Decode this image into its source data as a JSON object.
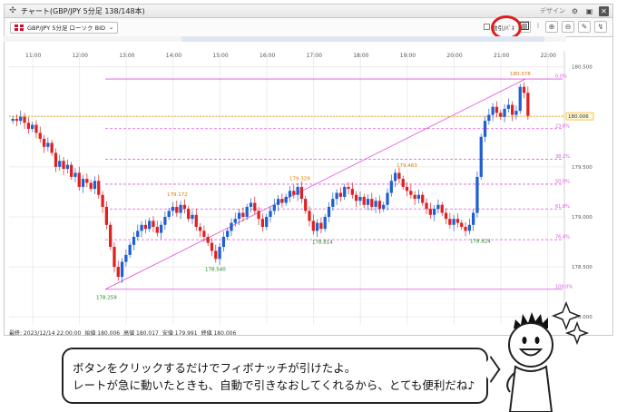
{
  "window": {
    "title": "チャート(GBP/JPY 5分足 138/148本)",
    "design_label": "デザイン",
    "title_icons": [
      "gear-icon",
      "window-icon",
      "close-icon"
    ]
  },
  "toolbar": {
    "symbol_select": "GBP/JPY 5分足 ローソク BID",
    "checkbox_label": "数引/ﾊﾞﾈ",
    "buttons": [
      "fibonacci-icon",
      "menu-icon",
      "zoom-in-icon",
      "zoom-out-icon",
      "pen-icon",
      "draw-tool-icon"
    ]
  },
  "status": {
    "datetime": "最終: 2023/12/14 22:00:00",
    "open": "始値 180.006",
    "high": "高値 180.017",
    "low": "安値 179.991",
    "close": "終値 180.006"
  },
  "bubble": {
    "line1": "ボタンをクリックするだけでフィボナッチが引けたよ。",
    "line2": "レートが急に動いたときも、自動で引きなおしてくれるから、とても便利だね♪"
  },
  "colors": {
    "up": "#1f5fd1",
    "down": "#e02020",
    "fib": "#e050e0",
    "current_price_line": "#f0a500",
    "highlight": "#e41a1a"
  },
  "chart_data": {
    "type": "candlestick",
    "x_ticks": [
      "11:00",
      "12:00",
      "13:00",
      "14:00",
      "15:00",
      "16:00",
      "17:00",
      "18:00",
      "19:00",
      "20:00",
      "21:00",
      "22:00"
    ],
    "y_ticks": [
      "180.500",
      "180.000",
      "179.500",
      "179.000",
      "178.500",
      "178.000"
    ],
    "ylim": [
      177.92,
      180.66
    ],
    "current_price": "180.006",
    "fib_levels": [
      {
        "label": "0.0%",
        "price": 180.378
      },
      {
        "label": "23.6%",
        "price": 179.882
      },
      {
        "label": "38.2%",
        "price": 179.575
      },
      {
        "label": "50.0%",
        "price": 179.327
      },
      {
        "label": "61.8%",
        "price": 179.079
      },
      {
        "label": "76.4%",
        "price": 178.772
      },
      {
        "label": "100.0%",
        "price": 178.276
      }
    ],
    "annotations": [
      {
        "text": "179.172",
        "kind": "high"
      },
      {
        "text": "179.329",
        "kind": "high"
      },
      {
        "text": "179.463",
        "kind": "high"
      },
      {
        "text": "180.378",
        "kind": "high"
      },
      {
        "text": "178.259",
        "kind": "low"
      },
      {
        "text": "178.540",
        "kind": "low"
      },
      {
        "text": "178.814",
        "kind": "low"
      },
      {
        "text": "178.824",
        "kind": "low"
      }
    ],
    "candles_close": [
      179.98,
      179.96,
      180.0,
      179.94,
      179.88,
      179.92,
      179.84,
      179.78,
      179.7,
      179.74,
      179.64,
      179.5,
      179.56,
      179.48,
      179.52,
      179.4,
      179.44,
      179.3,
      179.38,
      179.34,
      179.28,
      179.36,
      179.22,
      179.1,
      178.92,
      178.7,
      178.5,
      178.4,
      178.55,
      178.62,
      178.72,
      178.8,
      178.86,
      178.92,
      178.88,
      178.96,
      178.9,
      178.84,
      178.92,
      179.0,
      179.06,
      179.1,
      179.04,
      179.12,
      179.08,
      178.98,
      179.02,
      178.9,
      178.86,
      178.8,
      178.74,
      178.66,
      178.58,
      178.7,
      178.8,
      178.86,
      178.94,
      178.98,
      179.04,
      179.0,
      179.1,
      179.14,
      179.06,
      178.98,
      178.9,
      179.0,
      179.06,
      179.12,
      179.18,
      179.14,
      179.2,
      179.26,
      179.22,
      179.3,
      179.18,
      179.06,
      178.96,
      178.86,
      178.94,
      178.88,
      179.0,
      179.1,
      179.18,
      179.24,
      179.2,
      179.3,
      179.28,
      179.22,
      179.16,
      179.2,
      179.12,
      179.18,
      179.1,
      179.16,
      179.08,
      179.12,
      179.24,
      179.36,
      179.44,
      179.38,
      179.3,
      179.26,
      179.22,
      179.18,
      179.22,
      179.14,
      179.08,
      179.02,
      179.08,
      179.12,
      179.04,
      178.98,
      178.92,
      178.98,
      178.94,
      178.9,
      178.86,
      178.92,
      179.04,
      179.4,
      179.8,
      179.96,
      180.02,
      180.1,
      180.04,
      180.0,
      180.08,
      180.12,
      180.02,
      180.06,
      180.3,
      180.24,
      180.01
    ]
  }
}
